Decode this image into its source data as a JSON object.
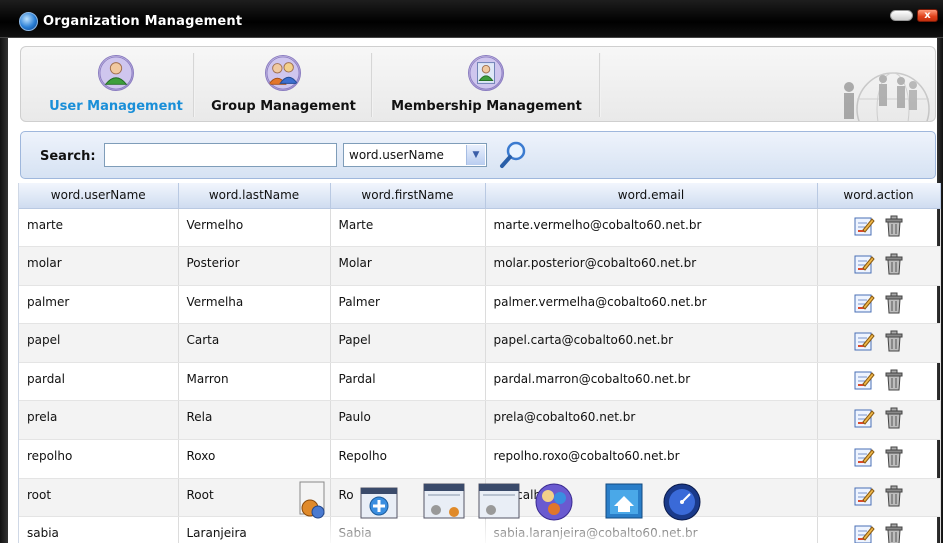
{
  "window": {
    "title": "Organization Management",
    "close_label": "x"
  },
  "nav": {
    "items": [
      {
        "label": "User Management",
        "active": true,
        "icon": "user-icon"
      },
      {
        "label": "Group Management",
        "active": false,
        "icon": "group-icon"
      },
      {
        "label": "Membership Management",
        "active": false,
        "icon": "membership-icon"
      }
    ]
  },
  "search": {
    "label": "Search:",
    "value": "",
    "placeholder": "",
    "field_selected": "word.userName"
  },
  "table": {
    "columns": [
      "word.userName",
      "word.lastName",
      "word.firstName",
      "word.email",
      "word.action"
    ],
    "rows": [
      {
        "userName": "marte",
        "lastName": "Vermelho",
        "firstName": "Marte",
        "email": "marte.vermelho@cobalto60.net.br"
      },
      {
        "userName": "molar",
        "lastName": "Posterior",
        "firstName": "Molar",
        "email": "molar.posterior@cobalto60.net.br"
      },
      {
        "userName": "palmer",
        "lastName": "Vermelha",
        "firstName": "Palmer",
        "email": "palmer.vermelha@cobalto60.net.br"
      },
      {
        "userName": "papel",
        "lastName": "Carta",
        "firstName": "Papel",
        "email": "papel.carta@cobalto60.net.br"
      },
      {
        "userName": "pardal",
        "lastName": "Marron",
        "firstName": "Pardal",
        "email": "pardal.marron@cobalto60.net.br"
      },
      {
        "userName": "prela",
        "lastName": "Rela",
        "firstName": "Paulo",
        "email": "prela@cobalto60.net.br"
      },
      {
        "userName": "repolho",
        "lastName": "Roxo",
        "firstName": "Repolho",
        "email": "repolho.roxo@cobalto60.net.br"
      },
      {
        "userName": "root",
        "lastName": "Root",
        "firstName": "Ro",
        "email": "@localhost"
      },
      {
        "userName": "sabia",
        "lastName": "Laranjeira",
        "firstName": "Sabia",
        "email": "sabia.laranjeira@cobalto60.net.br"
      }
    ]
  },
  "dock": {
    "icons": [
      "document-gear-icon",
      "add-window-icon",
      "window-settings-users-icon",
      "window-settings-icon",
      "organization-icon",
      "home-window-icon",
      "dashboard-gauge-icon"
    ]
  },
  "colors": {
    "active_nav": "#1a8fd8",
    "header_bg": "#cfdcf0",
    "titlebar": "#000000"
  }
}
